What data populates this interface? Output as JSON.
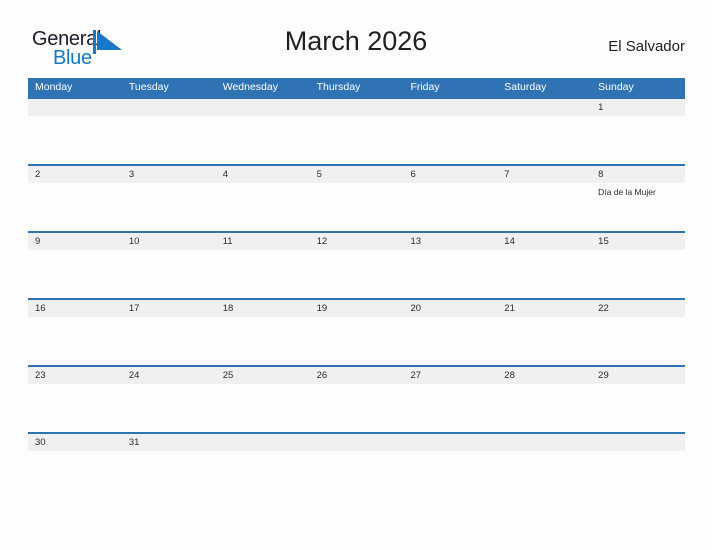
{
  "brand": {
    "name_part1": "General",
    "name_part2": "Blue",
    "color_dark": "#1b1b29",
    "color_blue": "#1878c6",
    "flag_icon": "blue-triangle-flag-icon"
  },
  "header": {
    "title": "March 2026",
    "country": "El Salvador"
  },
  "theme": {
    "header_blue": "#2f73b4",
    "row_band_gray": "#f0f0f0",
    "page_background": "#fdfdfd",
    "text_color": "#2a2a2a"
  },
  "calendar": {
    "month": "March",
    "year": "2026",
    "weekday_headers": [
      "Monday",
      "Tuesday",
      "Wednesday",
      "Thursday",
      "Friday",
      "Saturday",
      "Sunday"
    ],
    "weeks": [
      [
        {
          "day": "",
          "event": ""
        },
        {
          "day": "",
          "event": ""
        },
        {
          "day": "",
          "event": ""
        },
        {
          "day": "",
          "event": ""
        },
        {
          "day": "",
          "event": ""
        },
        {
          "day": "",
          "event": ""
        },
        {
          "day": "1",
          "event": ""
        }
      ],
      [
        {
          "day": "2",
          "event": ""
        },
        {
          "day": "3",
          "event": ""
        },
        {
          "day": "4",
          "event": ""
        },
        {
          "day": "5",
          "event": ""
        },
        {
          "day": "6",
          "event": ""
        },
        {
          "day": "7",
          "event": ""
        },
        {
          "day": "8",
          "event": "Día de la Mujer"
        }
      ],
      [
        {
          "day": "9",
          "event": ""
        },
        {
          "day": "10",
          "event": ""
        },
        {
          "day": "11",
          "event": ""
        },
        {
          "day": "12",
          "event": ""
        },
        {
          "day": "13",
          "event": ""
        },
        {
          "day": "14",
          "event": ""
        },
        {
          "day": "15",
          "event": ""
        }
      ],
      [
        {
          "day": "16",
          "event": ""
        },
        {
          "day": "17",
          "event": ""
        },
        {
          "day": "18",
          "event": ""
        },
        {
          "day": "19",
          "event": ""
        },
        {
          "day": "20",
          "event": ""
        },
        {
          "day": "21",
          "event": ""
        },
        {
          "day": "22",
          "event": ""
        }
      ],
      [
        {
          "day": "23",
          "event": ""
        },
        {
          "day": "24",
          "event": ""
        },
        {
          "day": "25",
          "event": ""
        },
        {
          "day": "26",
          "event": ""
        },
        {
          "day": "27",
          "event": ""
        },
        {
          "day": "28",
          "event": ""
        },
        {
          "day": "29",
          "event": ""
        }
      ],
      [
        {
          "day": "30",
          "event": ""
        },
        {
          "day": "31",
          "event": ""
        },
        {
          "day": "",
          "event": ""
        },
        {
          "day": "",
          "event": ""
        },
        {
          "day": "",
          "event": ""
        },
        {
          "day": "",
          "event": ""
        },
        {
          "day": "",
          "event": ""
        }
      ]
    ]
  }
}
